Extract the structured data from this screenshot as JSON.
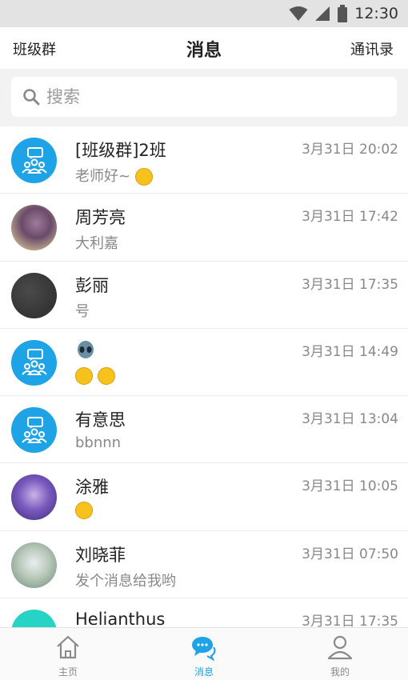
{
  "status_bar": {
    "time": "12:30"
  },
  "header": {
    "left_label": "班级群",
    "title": "消息",
    "right_label": "通讯录"
  },
  "search": {
    "placeholder": "搜索"
  },
  "conversations": [
    {
      "name": "[班级群]2班",
      "preview": "老师好~",
      "time": "3月31日 20:02",
      "avatar": "group-avatar",
      "preview_emoji": "grin-emoji"
    },
    {
      "name": "周芳亮",
      "preview": "大利嘉",
      "time": "3月31日 17:42",
      "avatar": "photo-avatar"
    },
    {
      "name": "彭丽",
      "preview": "号",
      "time": "3月31日 17:35",
      "avatar": "dark-avatar"
    },
    {
      "name": "",
      "preview": "",
      "time": "3月31日 14:49",
      "avatar": "group-avatar",
      "name_emoji": "alien-emoji",
      "preview_emoji": "dizzy-emoji grin-emoji"
    },
    {
      "name": "有意思",
      "preview": "bbnnn",
      "time": "3月31日 13:04",
      "avatar": "group-avatar"
    },
    {
      "name": "涂雅",
      "preview": "",
      "time": "3月31日 10:05",
      "avatar": "photo-avatar",
      "preview_emoji": "surprised-emoji"
    },
    {
      "name": "刘晓菲",
      "preview": "发个消息给我哟",
      "time": "3月31日 07:50",
      "avatar": "photo-avatar"
    },
    {
      "name": "Helianthus",
      "preview": "",
      "time": "3月31日 17:35",
      "avatar": "teal-avatar"
    }
  ],
  "tabs": [
    {
      "label": "主页",
      "icon": "home-icon",
      "active": false
    },
    {
      "label": "消息",
      "icon": "chat-bubble-icon",
      "active": true
    },
    {
      "label": "我的",
      "icon": "person-icon",
      "active": false
    }
  ],
  "colors": {
    "accent": "#1da3e6",
    "teal_avatar": "#27d3c4",
    "search_bg": "#f2f2f2"
  }
}
